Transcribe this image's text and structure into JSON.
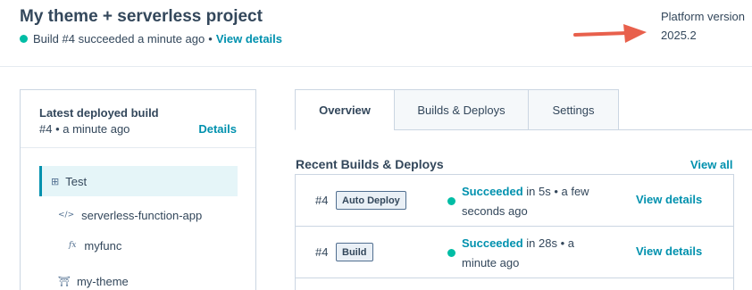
{
  "header": {
    "title": "My theme + serverless project",
    "status_text": "Build #4 succeeded a minute ago",
    "separator": "•",
    "view_details_label": "View details",
    "status_color": "#00bda5"
  },
  "platform": {
    "label": "Platform version",
    "value": "2025.2",
    "annotation_arrow_color": "#e8604c"
  },
  "left_panel": {
    "title": "Latest deployed build",
    "meta": "#4 • a minute ago",
    "details_label": "Details",
    "tree": [
      {
        "label": "Test",
        "icon": "grid-icon",
        "glyph": "⊞"
      },
      {
        "label": "serverless-function-app",
        "icon": "code-icon",
        "glyph": "</>"
      },
      {
        "label": "myfunc",
        "icon": "function-icon",
        "glyph": "fx"
      },
      {
        "label": "my-theme",
        "icon": "theme-icon",
        "glyph": "⛩"
      }
    ]
  },
  "tabs": [
    {
      "label": "Overview",
      "active": true
    },
    {
      "label": "Builds & Deploys",
      "active": false
    },
    {
      "label": "Settings",
      "active": false
    }
  ],
  "recent": {
    "title": "Recent Builds & Deploys",
    "view_all_label": "View all",
    "rows": [
      {
        "number": "#4",
        "tag": "Auto Deploy",
        "status": "Succeeded",
        "detail": " in 5s • a few seconds ago",
        "action": "View details"
      },
      {
        "number": "#4",
        "tag": "Build",
        "status": "Succeeded",
        "detail": " in 28s • a minute ago",
        "action": "View details"
      }
    ]
  },
  "colors": {
    "accent": "#0091ae",
    "success": "#00bda5",
    "text": "#33475b"
  }
}
